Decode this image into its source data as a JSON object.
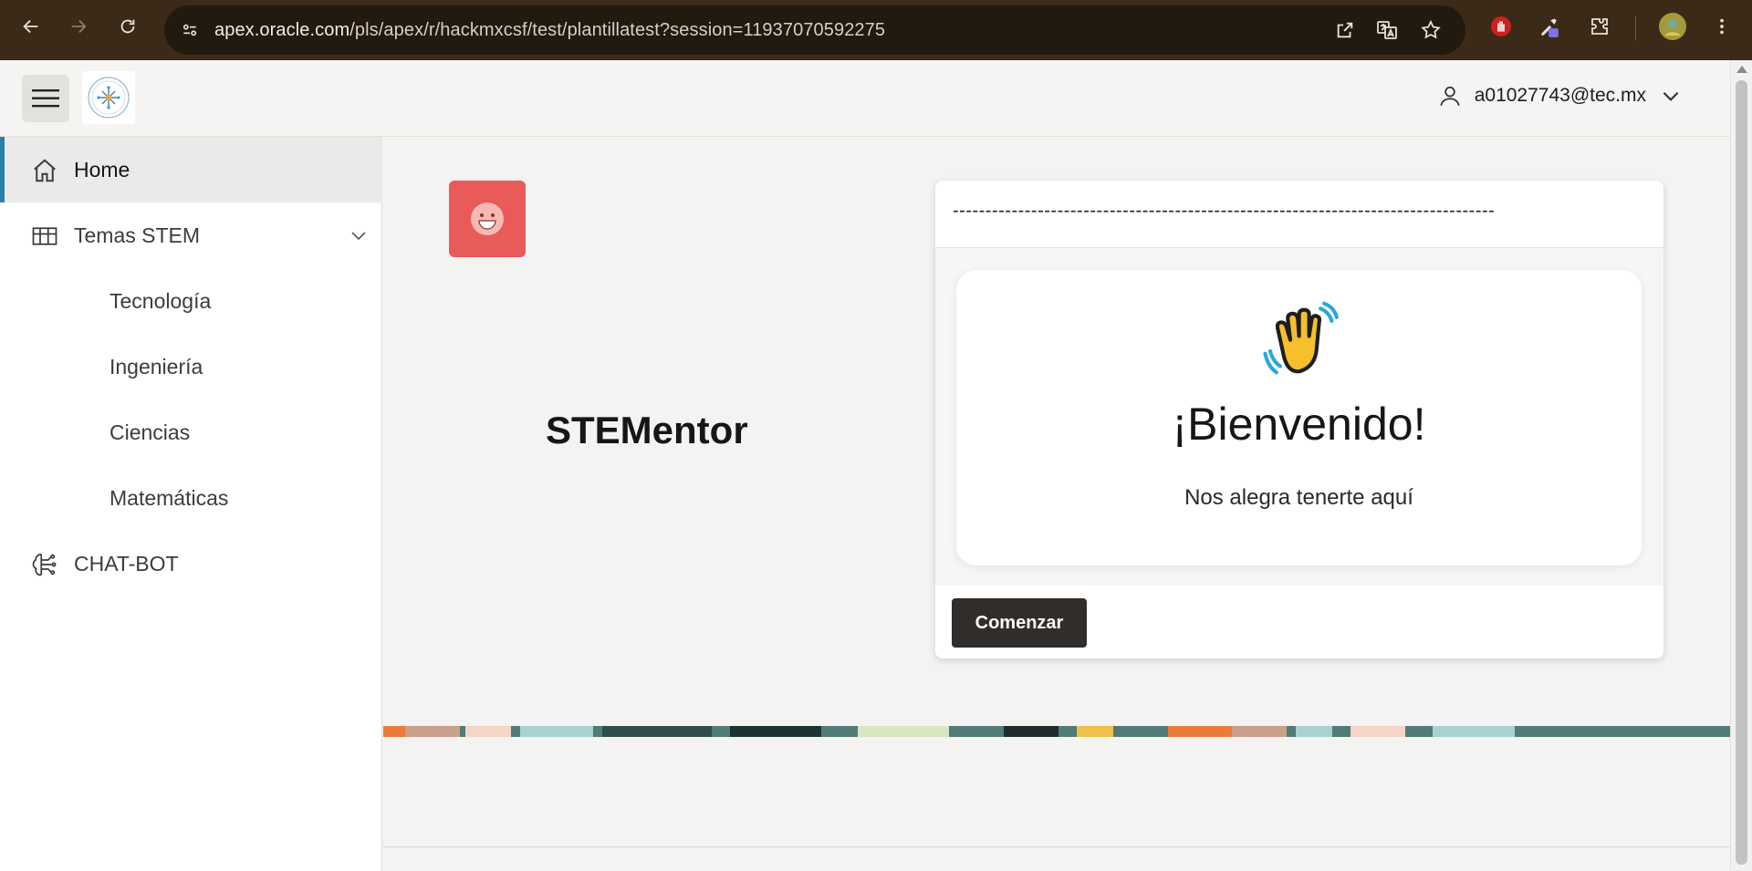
{
  "browser": {
    "url_host": "apex.oracle.com",
    "url_path": "/pls/apex/r/hackmxcsf/test/plantillatest?session=11937070592275",
    "icons": [
      "back-icon",
      "forward-icon",
      "reload-icon",
      "site-settings-icon",
      "open-in-app-icon",
      "translate-icon",
      "bookmark-star-icon",
      "extension-red-hand-icon",
      "extension-eyedropper-icon",
      "extensions-puzzle-icon",
      "profile-avatar-icon",
      "more-vert-icon"
    ]
  },
  "header": {
    "user_email": "a01027743@tec.mx"
  },
  "sidebar": {
    "items": [
      {
        "label": "Home",
        "icon": "home-icon"
      },
      {
        "label": "Temas STEM",
        "icon": "grid-icon"
      },
      {
        "label": "Tecnología"
      },
      {
        "label": "Ingeniería"
      },
      {
        "label": "Ciencias"
      },
      {
        "label": "Matemáticas"
      },
      {
        "label": "CHAT-BOT",
        "icon": "ai-brain-icon"
      }
    ]
  },
  "main": {
    "app_title": "STEMentor",
    "card": {
      "dashes": "-----------------------------------------------------------------------------------",
      "welcome_title": "¡Bienvenido!",
      "welcome_sub": "Nos alegra tenerte aquí",
      "start_button": "Comenzar"
    }
  },
  "colors": {
    "chrome_bg": "#3b2a17",
    "accent_bar": "#2a7fa8",
    "avatar_tile": "#e85b58",
    "button_dark": "#312d2a"
  }
}
